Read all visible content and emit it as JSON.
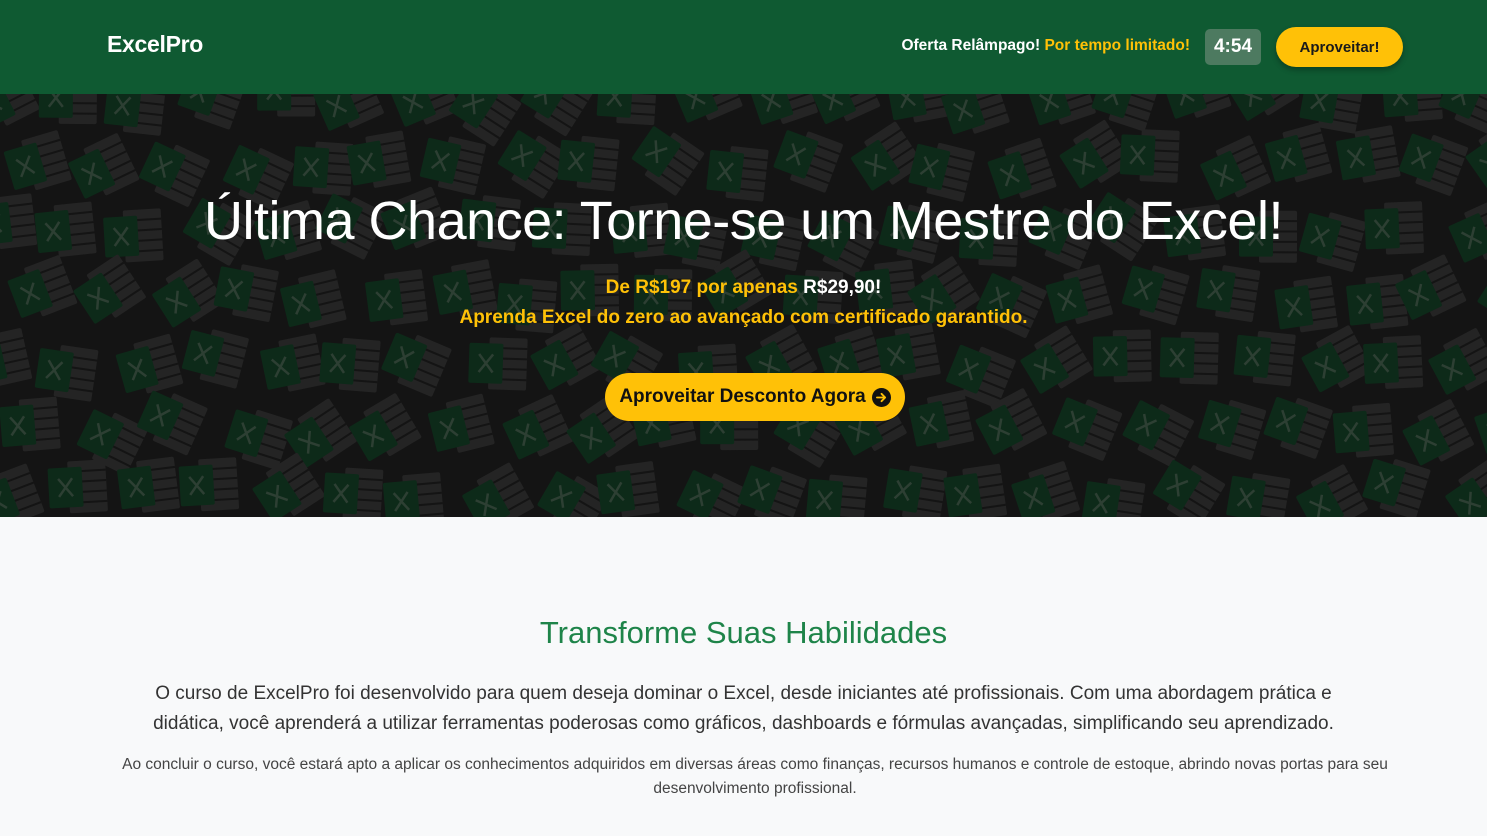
{
  "header": {
    "brand": "ExcelPro",
    "offer_label": "Oferta Relâmpago!",
    "offer_highlight": "Por tempo limitado!",
    "timer": "4:54",
    "cta_label": "Aproveitar!"
  },
  "hero": {
    "title": "Última Chance: Torne-se um Mestre do Excel!",
    "price_prefix": "De R$197 por apenas",
    "price_value": "R$29,90!",
    "subtitle": "Aprenda Excel do zero ao avançado com certificado garantido.",
    "cta_label": "Aproveitar Desconto Agora",
    "cta_icon": "arrow-right-circle-icon",
    "background_icon": "excel-logo-icon"
  },
  "section": {
    "title": "Transforme Suas Habilidades",
    "paragraph1": "O curso de ExcelPro foi desenvolvido para quem deseja dominar o Excel, desde iniciantes até profissionais. Com uma abordagem prática e didática, você aprenderá a utilizar ferramentas poderosas como gráficos, dashboards e fórmulas avançadas, simplificando seu aprendizado.",
    "paragraph2": "Ao concluir o curso, você estará apto a aplicar os conhecimentos adquiridos em diversas áreas como finanças, recursos humanos e controle de estoque, abrindo novas portas para seu desenvolvimento profissional."
  },
  "colors": {
    "header_bg": "#0f5a32",
    "accent_yellow": "#ffc107",
    "section_title_green": "#1e8449",
    "hero_bg": "#141414"
  }
}
